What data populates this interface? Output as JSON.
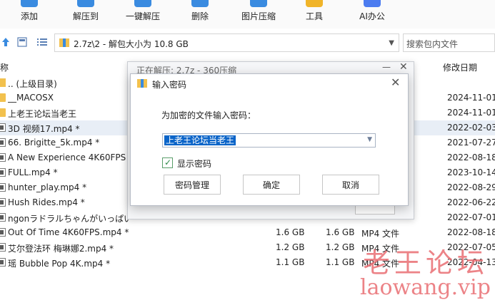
{
  "toolbar": {
    "buttons": [
      {
        "label": "添加",
        "icon": "add-icon",
        "color": "#3a8be0"
      },
      {
        "label": "解压到",
        "icon": "extract-to-icon",
        "color": "#3a8be0"
      },
      {
        "label": "一键解压",
        "icon": "one-click-extract-icon",
        "color": "#3a8be0"
      },
      {
        "label": "删除",
        "icon": "delete-icon",
        "color": "#3a8be0"
      },
      {
        "label": "图片压缩",
        "icon": "image-compress-icon",
        "color": "#3a8be0"
      },
      {
        "label": "工具",
        "icon": "tools-icon",
        "color": "#f0b429"
      },
      {
        "label": "AI办公",
        "icon": "ai-office-icon",
        "color": "#4c7cf0"
      }
    ]
  },
  "address": {
    "path": "2.7z\\2 - 解包大小为 10.8 GB",
    "search_placeholder": "搜索包内文件"
  },
  "columns": {
    "name": "称",
    "date": "修改日期"
  },
  "files": [
    {
      "name": ".. (上级目录)",
      "size": "",
      "packed": "",
      "type": "",
      "date": "",
      "kind": "parent"
    },
    {
      "name": "__MACOSX",
      "size": "",
      "packed": "",
      "type": "",
      "date": "2024-11-01",
      "kind": "folder"
    },
    {
      "name": "上老王论坛当老王",
      "size": "",
      "packed": "",
      "type": "",
      "date": "2024-11-01",
      "kind": "folder"
    },
    {
      "name": "3D 视频17.mp4 *",
      "size": "",
      "packed": "",
      "type": "",
      "date": "2022-02-03",
      "kind": "video",
      "selected": true
    },
    {
      "name": "66. Brigitte_5k.mp4 *",
      "size": "",
      "packed": "",
      "type": "",
      "date": "2021-07-27",
      "kind": "video"
    },
    {
      "name": "A New Experience 4K60FPS M",
      "size": "",
      "packed": "",
      "type": "",
      "date": "2022-08-18",
      "kind": "video"
    },
    {
      "name": "FULL.mp4 *",
      "size": "",
      "packed": "",
      "type": "",
      "date": "2023-10-14",
      "kind": "video"
    },
    {
      "name": "hunter_play.mp4 *",
      "size": "",
      "packed": "",
      "type": "",
      "date": "2022-08-29",
      "kind": "video"
    },
    {
      "name": "Hush Rides.mp4 *",
      "size": "",
      "packed": "",
      "type": "",
      "date": "2022-06-22",
      "kind": "video"
    },
    {
      "name": "ngonラドラルちゃんがいっぱい",
      "size": "",
      "packed": "",
      "type": "",
      "date": "2022-07-01",
      "kind": "video"
    },
    {
      "name": "Out Of Time 4K60FPS.mp4 *",
      "size": "1.6 GB",
      "packed": "1.6 GB",
      "type": "MP4 文件",
      "date": "2022-08-18",
      "kind": "video"
    },
    {
      "name": "艾尔登法环 梅琳娜2.mp4 *",
      "size": "1.2 GB",
      "packed": "1.2 GB",
      "type": "MP4 文件",
      "date": "2022-07-05",
      "kind": "video"
    },
    {
      "name": "瑶 Bubble Pop 4K.mp4 *",
      "size": "1.1 GB",
      "packed": "1.1 GB",
      "type": "MP4 文件",
      "date": "2022-04-13",
      "kind": "video"
    }
  ],
  "progress_window": {
    "title": "正在解压: 2.7z - 360压缩",
    "minimize": "—",
    "close": "✕"
  },
  "dialog": {
    "title": "输入密码",
    "close": "✕",
    "prompt": "为加密的文件输入密码：",
    "password_value": "上老王论坛当老王",
    "show_password_label": "显示密码",
    "show_password_checked": true,
    "buttons": {
      "manage": "密码管理",
      "ok": "确定",
      "cancel": "取消"
    }
  },
  "watermark": {
    "cn": "老王论坛",
    "en": "laowang.vip"
  }
}
